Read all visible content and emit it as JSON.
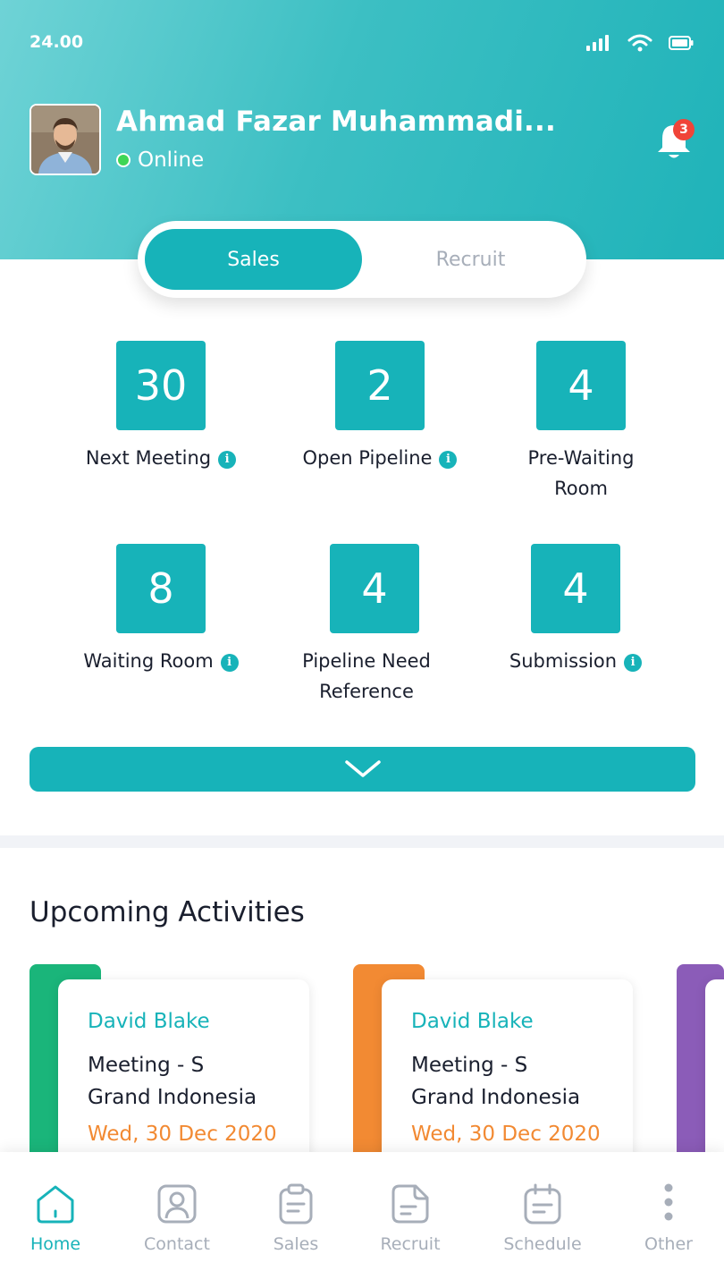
{
  "status_bar": {
    "time": "24.00",
    "icons": [
      "signal-icon",
      "wifi-icon",
      "battery-icon"
    ]
  },
  "profile": {
    "name": "Ahmad Fazar Muhammadi...",
    "status": "Online",
    "notification_count": "3"
  },
  "tabs": {
    "active": "Sales",
    "inactive": "Recruit"
  },
  "stats": [
    {
      "value": "30",
      "label": "Next Meeting",
      "info": true
    },
    {
      "value": "2",
      "label": "Open Pipeline",
      "info": true
    },
    {
      "value": "4",
      "label_line1": "Pre-Waiting",
      "label_line2": "Room",
      "info": false
    },
    {
      "value": "8",
      "label": "Waiting Room",
      "info": true
    },
    {
      "value": "4",
      "label_line1": "Pipeline Need",
      "label_line2": "Reference",
      "info": false
    },
    {
      "value": "4",
      "label": "Submission",
      "info": true
    }
  ],
  "expand": {
    "icon": "chevron-down-icon"
  },
  "activities": {
    "title": "Upcoming Activities",
    "cards": [
      {
        "name": "David Blake",
        "desc_line1": "Meeting - S",
        "desc_line2": "Grand Indonesia",
        "date": "Wed, 30 Dec 2020",
        "accent": "#1ab57a"
      },
      {
        "name": "David Blake",
        "desc_line1": "Meeting - S",
        "desc_line2": "Grand Indonesia",
        "date": "Wed, 30 Dec 2020",
        "accent": "#f28a33"
      }
    ],
    "third_accent": "#8b5cb8"
  },
  "nav": [
    {
      "label": "Home",
      "icon": "home-icon",
      "active": true
    },
    {
      "label": "Contact",
      "icon": "contact-icon",
      "active": false
    },
    {
      "label": "Sales",
      "icon": "clipboard-icon",
      "active": false
    },
    {
      "label": "Recruit",
      "icon": "document-icon",
      "active": false
    },
    {
      "label": "Schedule",
      "icon": "calendar-icon",
      "active": false
    },
    {
      "label": "Other",
      "icon": "more-vertical-icon",
      "active": false
    }
  ],
  "colors": {
    "primary": "#17b3b9",
    "text": "#1a1f2e",
    "muted": "#a7aeb9",
    "date": "#f28a33",
    "badge": "#f04438",
    "online": "#3ed655"
  }
}
